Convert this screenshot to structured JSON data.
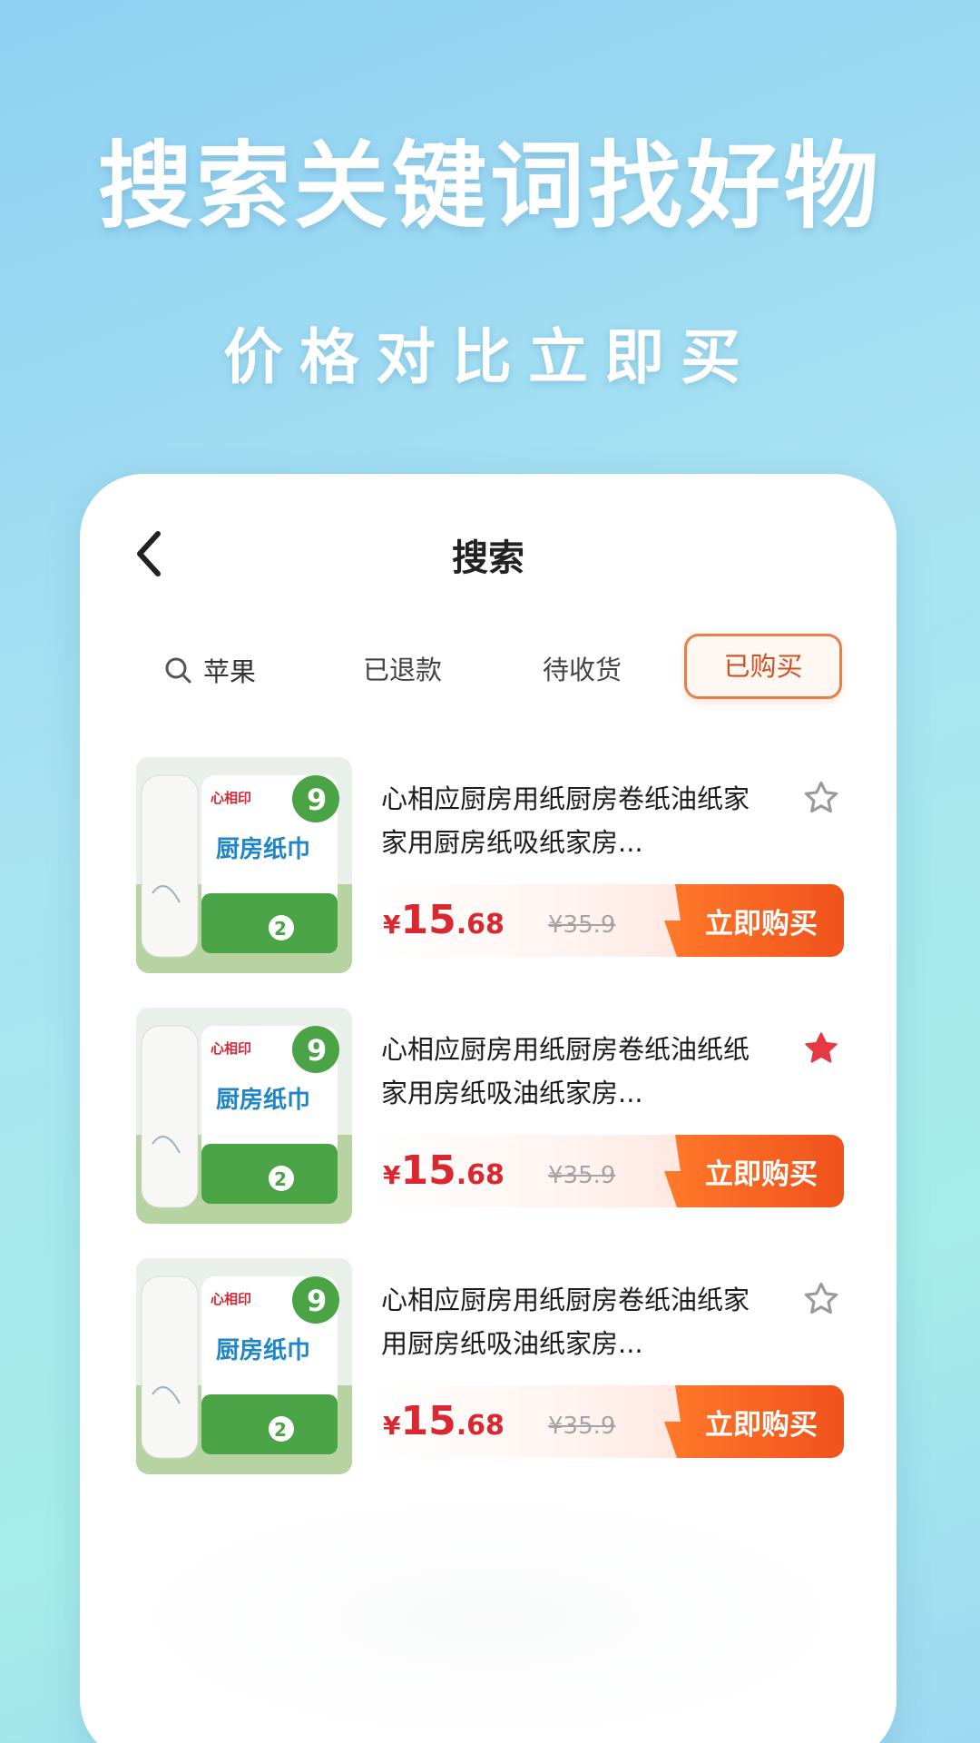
{
  "hero": {
    "title": "搜索关键词找好物",
    "subtitle": "价格对比立即买"
  },
  "nav": {
    "title": "搜索"
  },
  "filters": {
    "search_label": "苹果",
    "tabs": [
      "已退款",
      "待收货",
      "已购买"
    ],
    "active_tab": "已购买"
  },
  "products": [
    {
      "title": "心相应厨房用纸厨房卷纸油纸家家用厨房纸吸纸家房...",
      "price_yen": "¥",
      "price_int": "15",
      "price_dec": ".68",
      "original_price": "¥35.9",
      "buy_label": "立即购买",
      "favorited": false
    },
    {
      "title": "心相应厨房用纸厨房卷纸油纸纸家用房纸吸油纸家房...",
      "price_yen": "¥",
      "price_int": "15",
      "price_dec": ".68",
      "original_price": "¥35.9",
      "buy_label": "立即购买",
      "favorited": true
    },
    {
      "title": "心相应厨房用纸厨房卷纸油纸家用厨房纸吸油纸家房...",
      "price_yen": "¥",
      "price_int": "15",
      "price_dec": ".68",
      "original_price": "¥35.9",
      "buy_label": "立即购买",
      "favorited": false
    }
  ],
  "product_image": {
    "brand": "心相印",
    "name": "厨房纸巾",
    "badge": "9",
    "count": "2"
  },
  "colors": {
    "accent": "#f0521c",
    "price": "#d9282f",
    "star_active": "#e53945",
    "star_inactive": "#9a9a9a"
  }
}
